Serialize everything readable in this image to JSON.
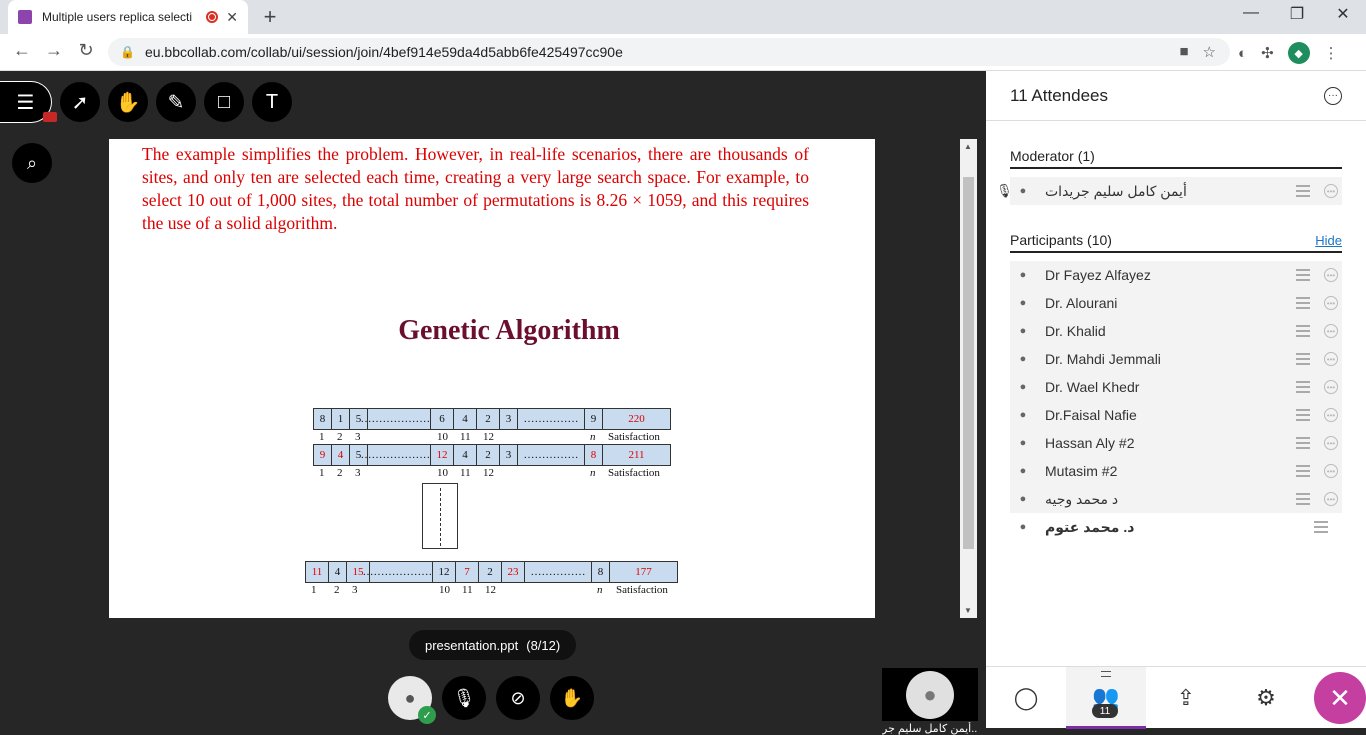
{
  "browser": {
    "tab_title": "Multiple users replica selecti",
    "new_tab": "+",
    "tab_close": "✕",
    "url": "eu.bbcollab.com/collab/ui/session/join/4bef914e59da4d5abb6fe425497cc90e",
    "minimize": "—",
    "restore": "❐",
    "close": "✕",
    "back": "←",
    "forward": "→",
    "reload": "↻",
    "lock": "🔒",
    "profile": "◆"
  },
  "slide": {
    "paragraph": "The example simplifies the problem. However, in real-life scenarios, there are thousands of sites, and only ten are selected each time, creating a very large search space. For example, to select 10 out of 1,000 sites, the total number of permutations is 8.26 × 1059, and this requires the use of a solid algorithm.",
    "title": "Genetic Algorithm",
    "chrom1": {
      "cells": [
        "8",
        "1",
        "5",
        "…………………",
        "6",
        "4",
        "2",
        "3",
        "……………",
        "9",
        "220"
      ]
    },
    "chrom2": {
      "cells": [
        "9",
        "4",
        "5",
        "…………………",
        "12",
        "4",
        "2",
        "3",
        "……………",
        "8",
        "211"
      ]
    },
    "chrom3": {
      "cells": [
        "11",
        "4",
        "15",
        "…………………",
        "12",
        "7",
        "2",
        "23",
        "……………",
        "8",
        "177"
      ]
    },
    "idx": {
      "i1": "1",
      "i2": "2",
      "i3": "3",
      "i10": "10",
      "i11": "11",
      "i12": "12",
      "n": "n",
      "sat": "Satisfaction"
    }
  },
  "stage": {
    "file_name": "presentation.ppt",
    "page": "(8/12)",
    "self_name": "أيمن كامل سليم جر..."
  },
  "panel": {
    "title": "11 Attendees",
    "moderator_head": "Moderator (1)",
    "moderator": "أيمن كامل سليم جريدات",
    "participants_head": "Participants (10)",
    "hide": "Hide",
    "participants": [
      "Dr Fayez Alfayez",
      "Dr. Alourani",
      "Dr. Khalid",
      "Dr. Mahdi Jemmali",
      "Dr. Wael Khedr",
      "Dr.Faisal Nafie",
      "Hassan Aly #2",
      "Mutasim #2",
      "د محمد وجيه",
      "د. محمد عتوم"
    ],
    "attendee_count": "11"
  },
  "colors": {
    "accent": "#7b2ea8",
    "close": "#c43fa0",
    "slide_text": "#dd0000",
    "cell": "#c9dbef"
  }
}
